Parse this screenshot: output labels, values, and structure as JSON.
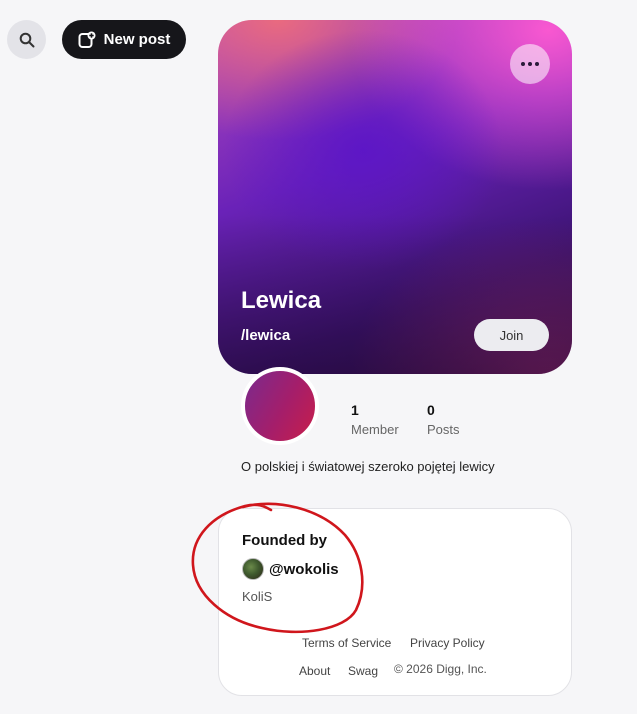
{
  "toolbar": {
    "search_icon": "search-icon",
    "new_post_label": "New post",
    "new_post_icon": "compose-icon"
  },
  "community": {
    "title": "Lewica",
    "slug": "/lewica",
    "join_label": "Join",
    "more_icon": "more-icon",
    "members_count": "1",
    "members_label": "Member",
    "posts_count": "0",
    "posts_label": "Posts",
    "description": "O polskiej i światowej szeroko pojętej lewicy"
  },
  "founded": {
    "title": "Founded by",
    "handle": "@wokolis",
    "display_name": "KoliS"
  },
  "footer": {
    "terms": "Terms of Service",
    "privacy": "Privacy Policy",
    "about": "About",
    "swag": "Swag",
    "copyright": "© 2026 Digg, Inc."
  },
  "colors": {
    "annotation": "#d0161c",
    "button_dark": "#16161a"
  }
}
